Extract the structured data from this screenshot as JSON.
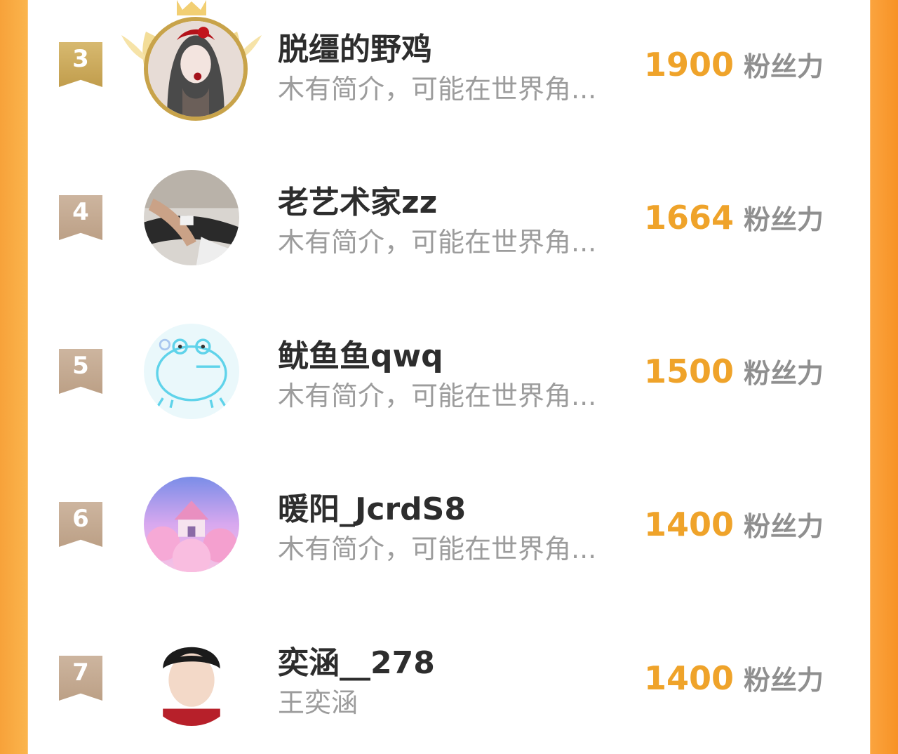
{
  "leaderboard": {
    "rows": [
      {
        "rank": "3",
        "name": "脱缰的野鸡",
        "bio": "木有简介，可能在世界角...",
        "fans_value": "1900",
        "fans_label": "粉丝力"
      },
      {
        "rank": "4",
        "name": "老艺术家zz",
        "bio": "木有简介，可能在世界角...",
        "fans_value": "1664",
        "fans_label": "粉丝力"
      },
      {
        "rank": "5",
        "name": "鱿鱼鱼qwq",
        "bio": "木有简介，可能在世界角...",
        "fans_value": "1500",
        "fans_label": "粉丝力"
      },
      {
        "rank": "6",
        "name": "暖阳_JcrdS8",
        "bio": "木有简介，可能在世界角...",
        "fans_value": "1400",
        "fans_label": "粉丝力"
      },
      {
        "rank": "7",
        "name": "奕涵__278",
        "bio": "王奕涵",
        "fans_value": "1400",
        "fans_label": "粉丝力"
      }
    ]
  },
  "colors": {
    "accent": "#efa32a",
    "name_text": "#2d2d2d",
    "bio_text": "#9c9c9c",
    "side_orange": "#f79a2f",
    "rank_gold": "#c9a85a",
    "rank_plain": "#c5aa93"
  }
}
